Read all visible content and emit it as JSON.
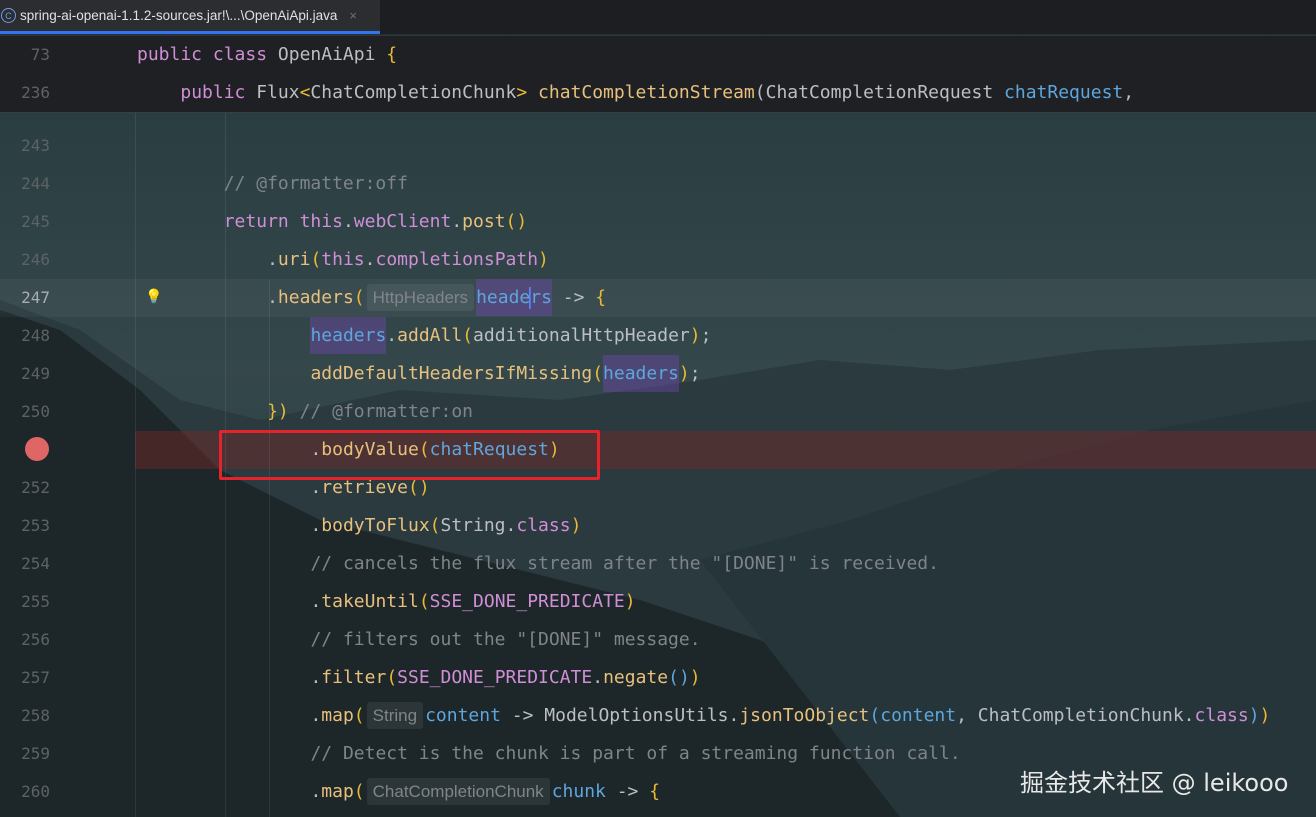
{
  "tab": {
    "icon": "class-icon",
    "icon_letter": "C",
    "title": "spring-ai-openai-1.1.2-sources.jar!\\...\\OpenAiApi.java",
    "close": "×"
  },
  "colors": {
    "accent": "#3574f0",
    "breakpoint": "#e06666",
    "highlight_box": "#e5232b"
  },
  "sticky": [
    {
      "num": "73",
      "indent": 0,
      "tokens": [
        {
          "t": "public ",
          "c": "k"
        },
        {
          "t": "class ",
          "c": "k"
        },
        {
          "t": "OpenAiApi ",
          "c": "d"
        },
        {
          "t": "{",
          "c": "b1"
        }
      ]
    },
    {
      "num": "236",
      "indent": 4,
      "tokens": [
        {
          "t": "public ",
          "c": "k"
        },
        {
          "t": "Flux",
          "c": "d"
        },
        {
          "t": "<",
          "c": "b1"
        },
        {
          "t": "ChatCompletionChunk",
          "c": "d"
        },
        {
          "t": "> ",
          "c": "b1"
        },
        {
          "t": "chatCompletionStream",
          "c": "f"
        },
        {
          "t": "(",
          "c": "d"
        },
        {
          "t": "ChatCompletionRequest ",
          "c": "d"
        },
        {
          "t": "chatRequest",
          "c": "p"
        },
        {
          "t": ",",
          "c": "d"
        }
      ]
    }
  ],
  "lines": [
    {
      "num": "243",
      "indent": 0,
      "tokens": []
    },
    {
      "num": "244",
      "indent": 8,
      "tokens": [
        {
          "t": "// @formatter:off",
          "c": "cm"
        }
      ]
    },
    {
      "num": "245",
      "indent": 8,
      "tokens": [
        {
          "t": "return ",
          "c": "k"
        },
        {
          "t": "this",
          "c": "k"
        },
        {
          "t": ".",
          "c": "d"
        },
        {
          "t": "webClient",
          "c": "cls"
        },
        {
          "t": ".",
          "c": "d"
        },
        {
          "t": "post",
          "c": "f"
        },
        {
          "t": "()",
          "c": "b1"
        }
      ]
    },
    {
      "num": "246",
      "indent": 12,
      "tokens": [
        {
          "t": ".",
          "c": "d"
        },
        {
          "t": "uri",
          "c": "f"
        },
        {
          "t": "(",
          "c": "b1"
        },
        {
          "t": "this",
          "c": "k"
        },
        {
          "t": ".",
          "c": "d"
        },
        {
          "t": "completionsPath",
          "c": "cls"
        },
        {
          "t": ")",
          "c": "b1"
        }
      ]
    },
    {
      "num": "247",
      "indent": 12,
      "current": true,
      "tokens": [
        {
          "t": ".",
          "c": "d"
        },
        {
          "t": "headers",
          "c": "f"
        },
        {
          "t": "(",
          "c": "b1"
        },
        {
          "t": "HttpHeaders",
          "c": "hint"
        },
        {
          "t": "heade",
          "c": "p hl"
        },
        {
          "t": "CARET",
          "c": "caret"
        },
        {
          "t": "rs",
          "c": "p hl"
        },
        {
          "t": " -> ",
          "c": "d"
        },
        {
          "t": "{",
          "c": "b1"
        }
      ]
    },
    {
      "num": "248",
      "indent": 16,
      "tokens": [
        {
          "t": "headers",
          "c": "p hl"
        },
        {
          "t": ".",
          "c": "d"
        },
        {
          "t": "addAll",
          "c": "f"
        },
        {
          "t": "(",
          "c": "b1"
        },
        {
          "t": "additionalHttpHeader",
          "c": "d"
        },
        {
          "t": ")",
          "c": "b1"
        },
        {
          "t": ";",
          "c": "d"
        }
      ]
    },
    {
      "num": "249",
      "indent": 16,
      "tokens": [
        {
          "t": "addDefaultHeadersIfMissing",
          "c": "f"
        },
        {
          "t": "(",
          "c": "b1"
        },
        {
          "t": "headers",
          "c": "p hl"
        },
        {
          "t": ")",
          "c": "b1"
        },
        {
          "t": ";",
          "c": "d"
        }
      ]
    },
    {
      "num": "250",
      "indent": 12,
      "tokens": [
        {
          "t": "})",
          "c": "b1"
        },
        {
          "t": " // @formatter:on",
          "c": "cm"
        }
      ]
    },
    {
      "num": "",
      "indent": 16,
      "breakpoint": true,
      "tokens": [
        {
          "t": ".",
          "c": "d"
        },
        {
          "t": "bodyValue",
          "c": "f"
        },
        {
          "t": "(",
          "c": "b1"
        },
        {
          "t": "chatRequest",
          "c": "p"
        },
        {
          "t": ")",
          "c": "b1"
        }
      ]
    },
    {
      "num": "252",
      "indent": 16,
      "tokens": [
        {
          "t": ".",
          "c": "d"
        },
        {
          "t": "retrieve",
          "c": "f"
        },
        {
          "t": "()",
          "c": "b1"
        }
      ]
    },
    {
      "num": "253",
      "indent": 16,
      "tokens": [
        {
          "t": ".",
          "c": "d"
        },
        {
          "t": "bodyToFlux",
          "c": "f"
        },
        {
          "t": "(",
          "c": "b1"
        },
        {
          "t": "String",
          "c": "d"
        },
        {
          "t": ".",
          "c": "d"
        },
        {
          "t": "class",
          "c": "k"
        },
        {
          "t": ")",
          "c": "b1"
        }
      ]
    },
    {
      "num": "254",
      "indent": 16,
      "tokens": [
        {
          "t": "// cancels the flux stream after the \"[DONE]\" is received.",
          "c": "cm"
        }
      ]
    },
    {
      "num": "255",
      "indent": 16,
      "tokens": [
        {
          "t": ".",
          "c": "d"
        },
        {
          "t": "takeUntil",
          "c": "f"
        },
        {
          "t": "(",
          "c": "b1"
        },
        {
          "t": "SSE_DONE_PREDICATE",
          "c": "cls"
        },
        {
          "t": ")",
          "c": "b1"
        }
      ]
    },
    {
      "num": "256",
      "indent": 16,
      "tokens": [
        {
          "t": "// filters out the \"[DONE]\" message.",
          "c": "cm"
        }
      ]
    },
    {
      "num": "257",
      "indent": 16,
      "tokens": [
        {
          "t": ".",
          "c": "d"
        },
        {
          "t": "filter",
          "c": "f"
        },
        {
          "t": "(",
          "c": "b1"
        },
        {
          "t": "SSE_DONE_PREDICATE",
          "c": "cls"
        },
        {
          "t": ".",
          "c": "d"
        },
        {
          "t": "negate",
          "c": "f"
        },
        {
          "t": "()",
          "c": "b2"
        },
        {
          "t": ")",
          "c": "b1"
        }
      ]
    },
    {
      "num": "258",
      "indent": 16,
      "tokens": [
        {
          "t": ".",
          "c": "d"
        },
        {
          "t": "map",
          "c": "f"
        },
        {
          "t": "(",
          "c": "b1"
        },
        {
          "t": "String",
          "c": "hint"
        },
        {
          "t": "content",
          "c": "p"
        },
        {
          "t": " -> ModelOptionsUtils.",
          "c": "d"
        },
        {
          "t": "jsonToObject",
          "c": "f"
        },
        {
          "t": "(",
          "c": "b2"
        },
        {
          "t": "content",
          "c": "p"
        },
        {
          "t": ", ChatCompletionChunk.",
          "c": "d"
        },
        {
          "t": "class",
          "c": "k"
        },
        {
          "t": ")",
          "c": "b2"
        },
        {
          "t": ")",
          "c": "b1"
        }
      ]
    },
    {
      "num": "259",
      "indent": 16,
      "tokens": [
        {
          "t": "// Detect is the chunk is part of a streaming function call.",
          "c": "cm"
        }
      ]
    },
    {
      "num": "260",
      "indent": 16,
      "tokens": [
        {
          "t": ".",
          "c": "d"
        },
        {
          "t": "map",
          "c": "f"
        },
        {
          "t": "(",
          "c": "b1"
        },
        {
          "t": "ChatCompletionChunk",
          "c": "hint"
        },
        {
          "t": "chunk",
          "c": "p"
        },
        {
          "t": " -> ",
          "c": "d"
        },
        {
          "t": "{",
          "c": "b1"
        }
      ]
    }
  ],
  "watermark": "掘金技术社区 @ leikooo"
}
